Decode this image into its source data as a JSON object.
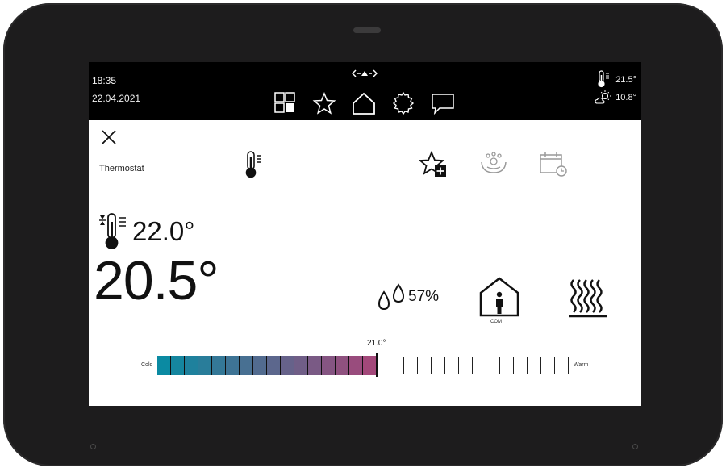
{
  "status_bar": {
    "time": "18:35",
    "date": "22.04.2021",
    "indoor_temp": "21.5°",
    "outdoor_temp": "10.8°"
  },
  "nav": {
    "items": [
      "apps-grid-icon",
      "favorites-star-icon",
      "home-icon",
      "settings-gear-icon",
      "messages-chat-icon"
    ]
  },
  "thermostat": {
    "title": "Thermostat",
    "setpoint": "22.0°",
    "current_temp": "20.5°",
    "humidity": "57%",
    "mode_label": "COM",
    "scale": {
      "cold_label": "Cold",
      "warm_label": "Warm",
      "value_label": "21.0°",
      "filled_segments": 16,
      "total_segments": 30,
      "cold_color": "#0b8aa2",
      "warm_color": "#a3487a"
    }
  }
}
